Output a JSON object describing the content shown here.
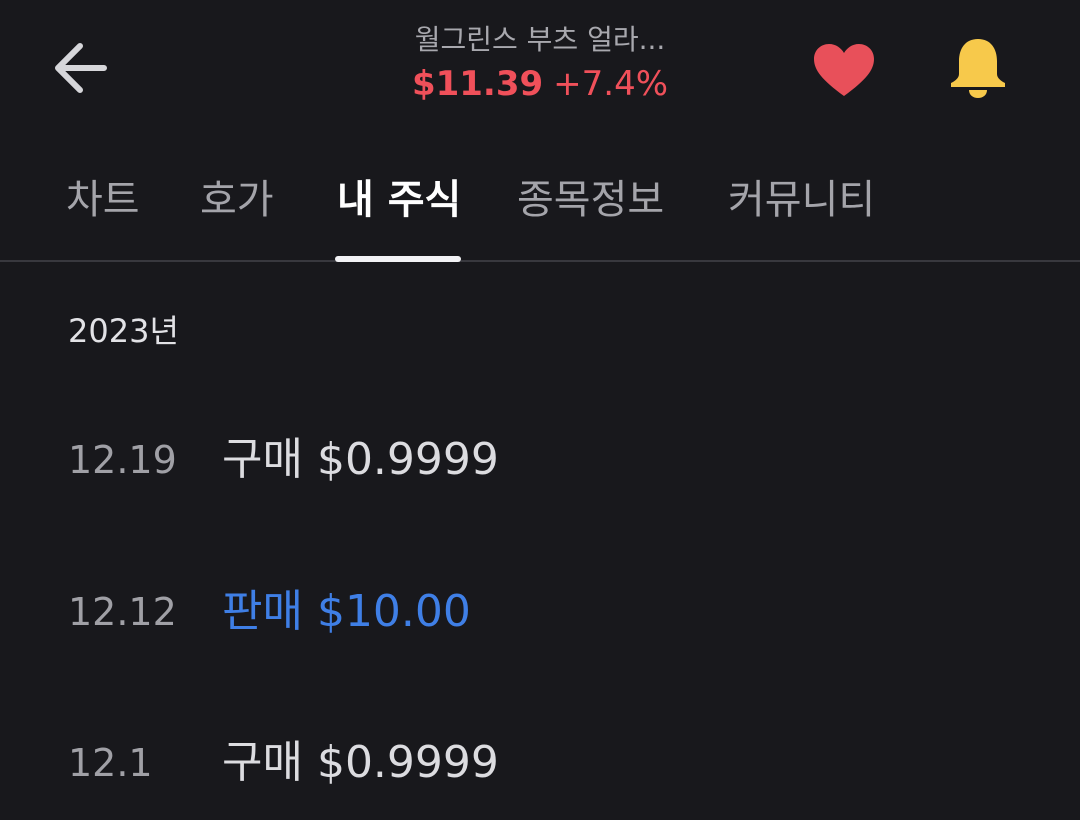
{
  "header": {
    "stock_name": "월그린스 부츠 얼라...",
    "price": "$11.39",
    "change": "+7.4%",
    "price_color": "#f0505a",
    "back_icon": "arrow-left-icon",
    "favorite_icon": "heart-icon",
    "favorite_color": "#e8505a",
    "alert_icon": "bell-icon",
    "alert_color": "#f7c94b"
  },
  "tabs": [
    {
      "label": "차트",
      "active": false
    },
    {
      "label": "호가",
      "active": false
    },
    {
      "label": "내 주식",
      "active": true
    },
    {
      "label": "종목정보",
      "active": false
    },
    {
      "label": "커뮤니티",
      "active": false
    }
  ],
  "history": {
    "year": "2023년",
    "rows": [
      {
        "date": "12.19",
        "description": "구매 $0.9999",
        "type": "buy"
      },
      {
        "date": "12.12",
        "description": "판매 $10.00",
        "type": "sell"
      },
      {
        "date": "12.1",
        "description": "구매 $0.9999",
        "type": "buy"
      }
    ],
    "sell_color": "#3f7fe6"
  }
}
